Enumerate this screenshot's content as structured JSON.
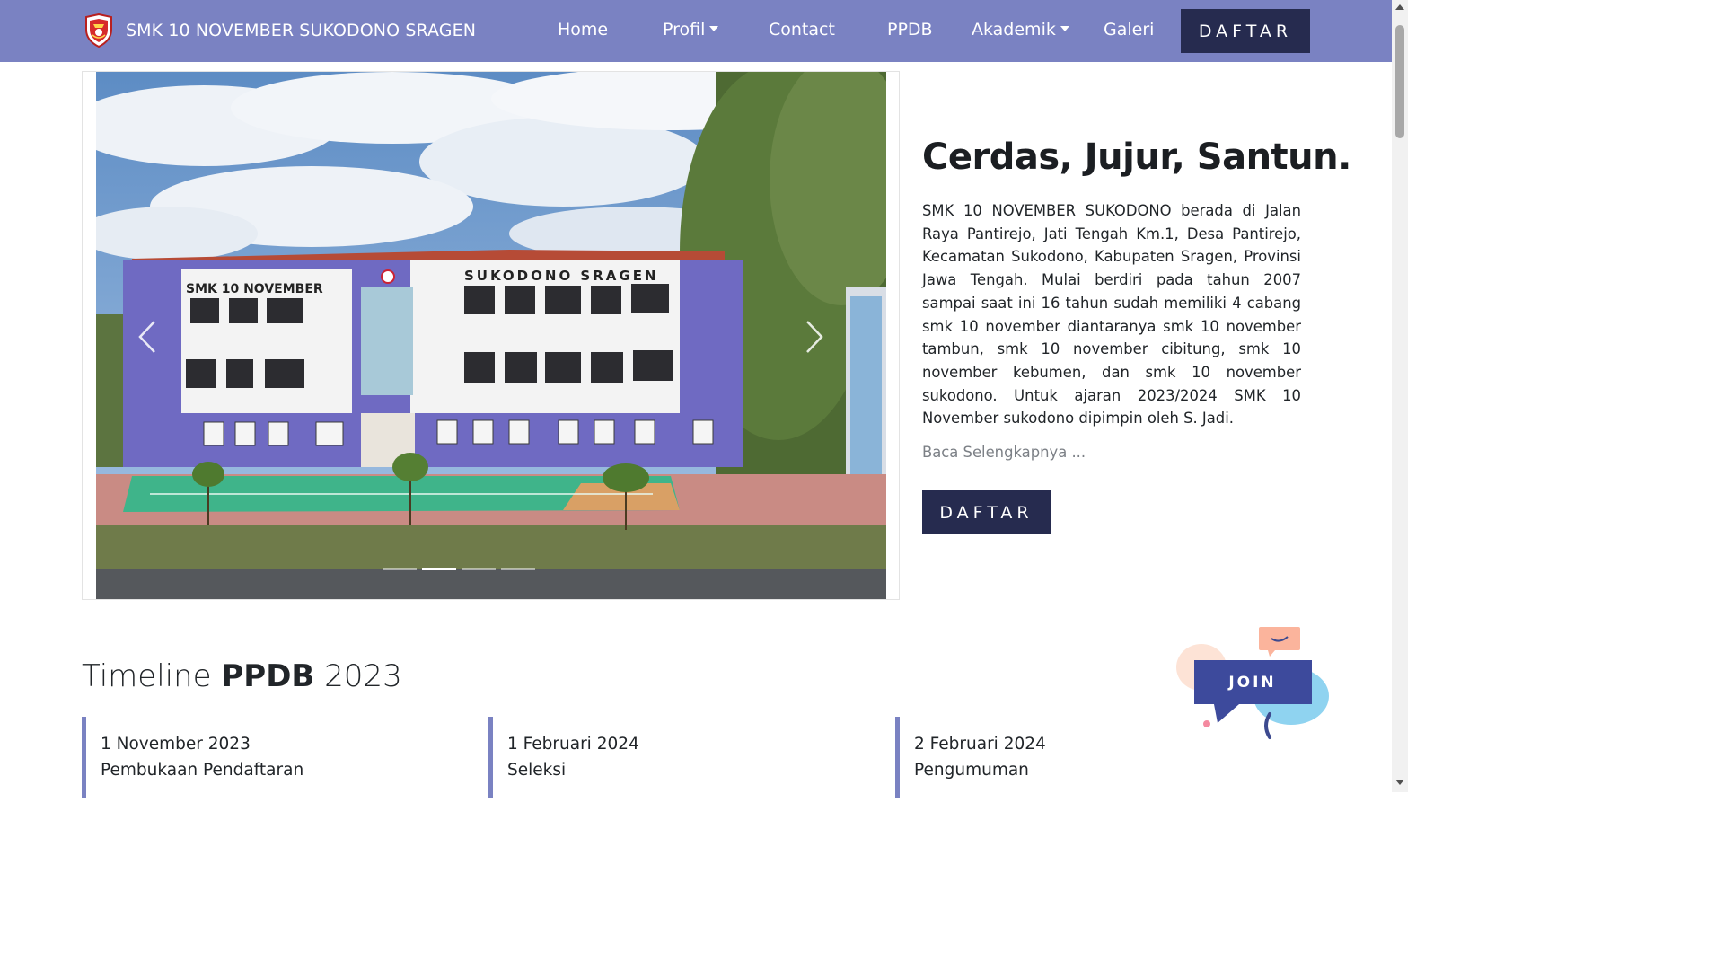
{
  "brand": {
    "name": "SMK 10 NOVEMBER SUKODONO SRAGEN",
    "logo_icon": "school-shield-icon"
  },
  "nav": {
    "home": "Home",
    "profil": "Profil",
    "contact": "Contact",
    "ppdb": "PPDB",
    "akademik": "Akademik",
    "galeri": "Galeri",
    "daftar": "DAFTAR"
  },
  "colors": {
    "navbar": "#7a82c2",
    "button": "#262b4f",
    "timeline_border": "#7a82c2"
  },
  "carousel": {
    "sign_left": "SMK 10 NOVEMBER",
    "sign_right": "SUKODONO SRAGEN",
    "prev_icon": "chevron-left-icon",
    "next_icon": "chevron-right-icon",
    "slide_count": 4,
    "active_slide": 2
  },
  "hero": {
    "title": "Cerdas, Jujur, Santun.",
    "description": "SMK 10 NOVEMBER SUKODONO berada di Jalan Raya Pantirejo, Jati Tengah Km.1, Desa Pantirejo, Kecamatan Sukodono, Kabupaten Sragen, Provinsi Jawa Tengah. Mulai berdiri pada tahun 2007 sampai saat ini 16 tahun sudah memiliki 4 cabang smk 10 november diantaranya smk 10 november tambun, smk 10 november cibitung, smk 10 november kebumen, dan smk 10 november sukodono. Untuk ajaran 2023/2024 SMK 10 November sukodono dipimpin oleh S. Jadi.",
    "read_more": "Baca Selengkapnya ...",
    "button": "DAFTAR"
  },
  "timeline": {
    "heading_prefix": "Timeline ",
    "heading_bold": "PPDB",
    "heading_suffix": " 2023",
    "items": [
      {
        "date": "1 November 2023",
        "label": "Pembukaan Pendaftaran"
      },
      {
        "date": "1 Februari 2024",
        "label": "Seleksi"
      },
      {
        "date": "2 Februari 2024",
        "label": "Pengumuman"
      }
    ]
  },
  "join_widget": {
    "label": "JOIN",
    "icon": "chat-bubble-icon"
  }
}
